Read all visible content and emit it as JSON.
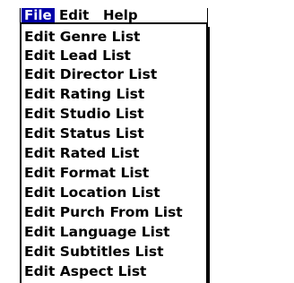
{
  "menubar": {
    "titles": [
      "File",
      "Edit",
      "Help"
    ],
    "active": "File"
  },
  "menu": {
    "items": [
      "Edit Genre List",
      "Edit Lead List",
      "Edit Director List",
      "Edit Rating List",
      "Edit Studio List",
      "Edit Status List",
      "Edit Rated List",
      "Edit Format List",
      "Edit Location List",
      "Edit Purch From List",
      "Edit Language List",
      "Edit Subtitles List",
      "Edit Aspect List"
    ]
  },
  "colors": {
    "highlight": "#0000a8",
    "text": "#000000",
    "background": "#ffffff"
  }
}
